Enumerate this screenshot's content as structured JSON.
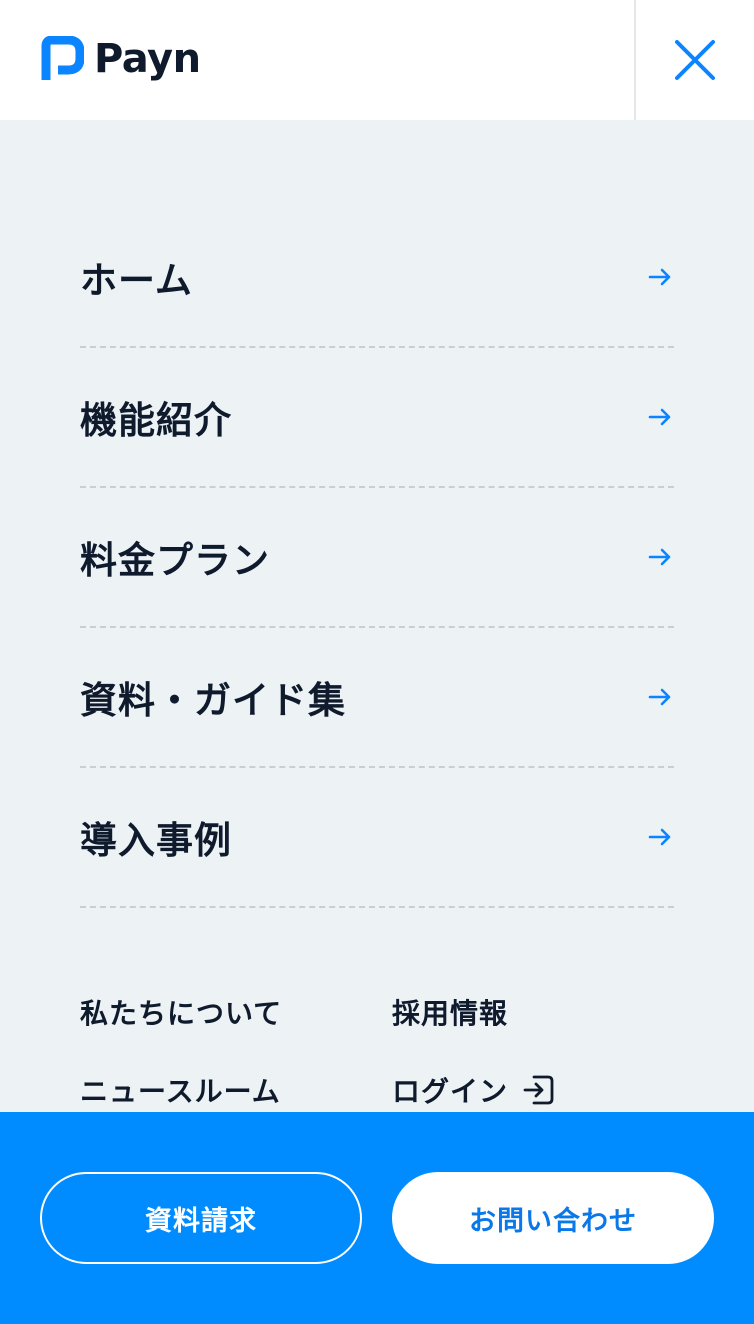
{
  "header": {
    "brand": "Payn",
    "close_icon": "close-icon",
    "logo_color": "#0a84ff"
  },
  "nav": {
    "items": [
      {
        "label": "ホーム",
        "icon": "arrow-right-icon"
      },
      {
        "label": "機能紹介",
        "icon": "arrow-right-icon"
      },
      {
        "label": "料金プラン",
        "icon": "arrow-right-icon"
      },
      {
        "label": "資料・ガイド集",
        "icon": "arrow-right-icon"
      },
      {
        "label": "導入事例",
        "icon": "arrow-right-icon"
      }
    ]
  },
  "sub_links": {
    "about": "私たちについて",
    "recruit": "採用情報",
    "news": "ニュースルーム",
    "login": "ログイン",
    "login_icon": "login-icon"
  },
  "footer": {
    "document_request": "資料請求",
    "contact": "お問い合わせ",
    "background": "#008cff"
  },
  "colors": {
    "accent": "#0a84ff",
    "text": "#0f1b2d",
    "page_bg": "#edf2f5"
  }
}
